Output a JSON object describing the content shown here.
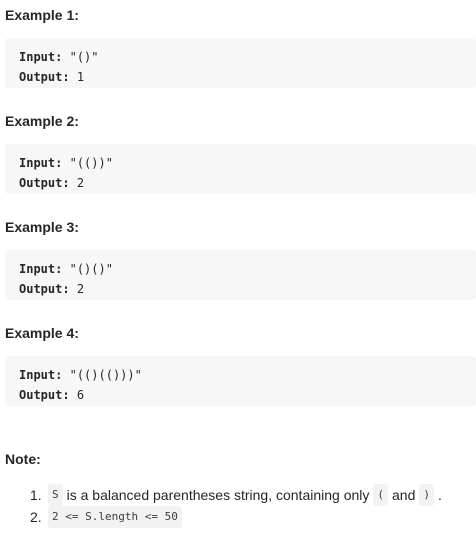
{
  "examples": [
    {
      "title": "Example 1:",
      "input_label": "Input:",
      "input_value": "\"()\"",
      "output_label": "Output:",
      "output_value": "1"
    },
    {
      "title": "Example 2:",
      "input_label": "Input:",
      "input_value": "\"(())\"",
      "output_label": "Output:",
      "output_value": "2"
    },
    {
      "title": "Example 3:",
      "input_label": "Input:",
      "input_value": "\"()()\"",
      "output_label": "Output:",
      "output_value": "2"
    },
    {
      "title": "Example 4:",
      "input_label": "Input:",
      "input_value": "\"(()(()))\"",
      "output_label": "Output:",
      "output_value": "6"
    }
  ],
  "note": {
    "title": "Note:",
    "items": [
      {
        "number": "1.",
        "code_s": "S",
        "text_middle": "is a balanced parentheses string, containing only",
        "code_open": "(",
        "text_and": "and",
        "code_close": ")",
        "text_end": "."
      },
      {
        "number": "2.",
        "code_constraint": "2 <= S.length <= 50"
      }
    ]
  }
}
